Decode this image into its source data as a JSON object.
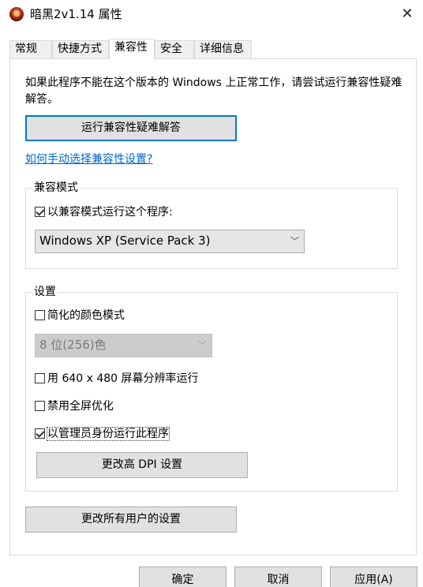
{
  "window": {
    "title": "暗黑2v1.14 属性",
    "app_icon": "diablo-app-icon"
  },
  "tabs": [
    {
      "label": "常规"
    },
    {
      "label": "快捷方式"
    },
    {
      "label": "兼容性"
    },
    {
      "label": "安全"
    },
    {
      "label": "详细信息"
    }
  ],
  "compat": {
    "intro": "如果此程序不能在这个版本的 Windows 上正常工作，请尝试运行兼容性疑难解答。",
    "troubleshoot_button": "运行兼容性疑难解答",
    "help_link": "如何手动选择兼容性设置?",
    "mode_group": {
      "label": "兼容模式",
      "checkbox_label": "以兼容模式运行这个程序:",
      "checkbox_checked": true,
      "selected_os": "Windows XP (Service Pack 3)"
    },
    "settings_group": {
      "label": "设置",
      "reduced_color_label": "简化的颜色模式",
      "reduced_color_checked": false,
      "color_select": "8 位(256)色",
      "res_640_label": "用 640 x 480 屏幕分辨率运行",
      "res_640_checked": false,
      "fullscreen_opt_label": "禁用全屏优化",
      "fullscreen_opt_checked": false,
      "admin_label": "以管理员身份运行此程序",
      "admin_checked": true,
      "dpi_button": "更改高 DPI 设置"
    },
    "all_users_button": "更改所有用户的设置"
  },
  "footer": {
    "ok": "确定",
    "cancel": "取消",
    "apply": "应用(A)"
  },
  "colors": {
    "focus_blue": "#0078d7",
    "link_blue": "#0066cc",
    "button_face": "#e1e1e1"
  }
}
